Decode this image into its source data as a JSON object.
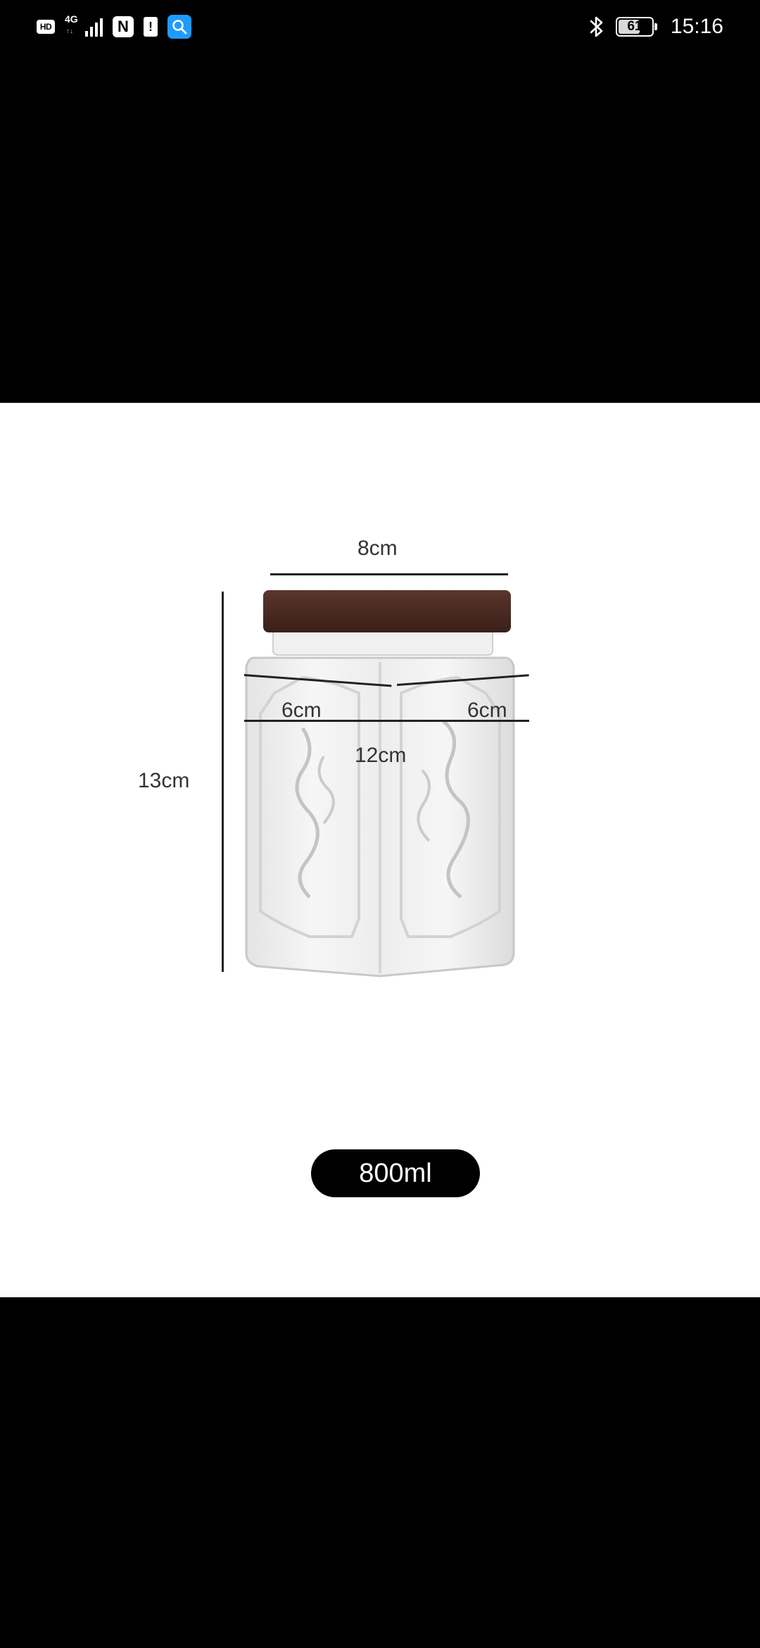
{
  "status_bar": {
    "hd": "HD",
    "network_type": "4G",
    "network_arrows": "↑↓",
    "signal_level": 4,
    "nfc": "N",
    "sim_alert": "!",
    "battery_level": "61",
    "time": "15:16"
  },
  "product": {
    "top_width_label": "8cm",
    "height_label": "13cm",
    "side_left_label": "6cm",
    "side_right_label": "6cm",
    "total_width_label": "12cm",
    "capacity_label": "800ml"
  },
  "colors": {
    "background": "#000000",
    "panel": "#ffffff",
    "lid": "#4a2a22",
    "search_icon_bg": "#1e9bff"
  }
}
